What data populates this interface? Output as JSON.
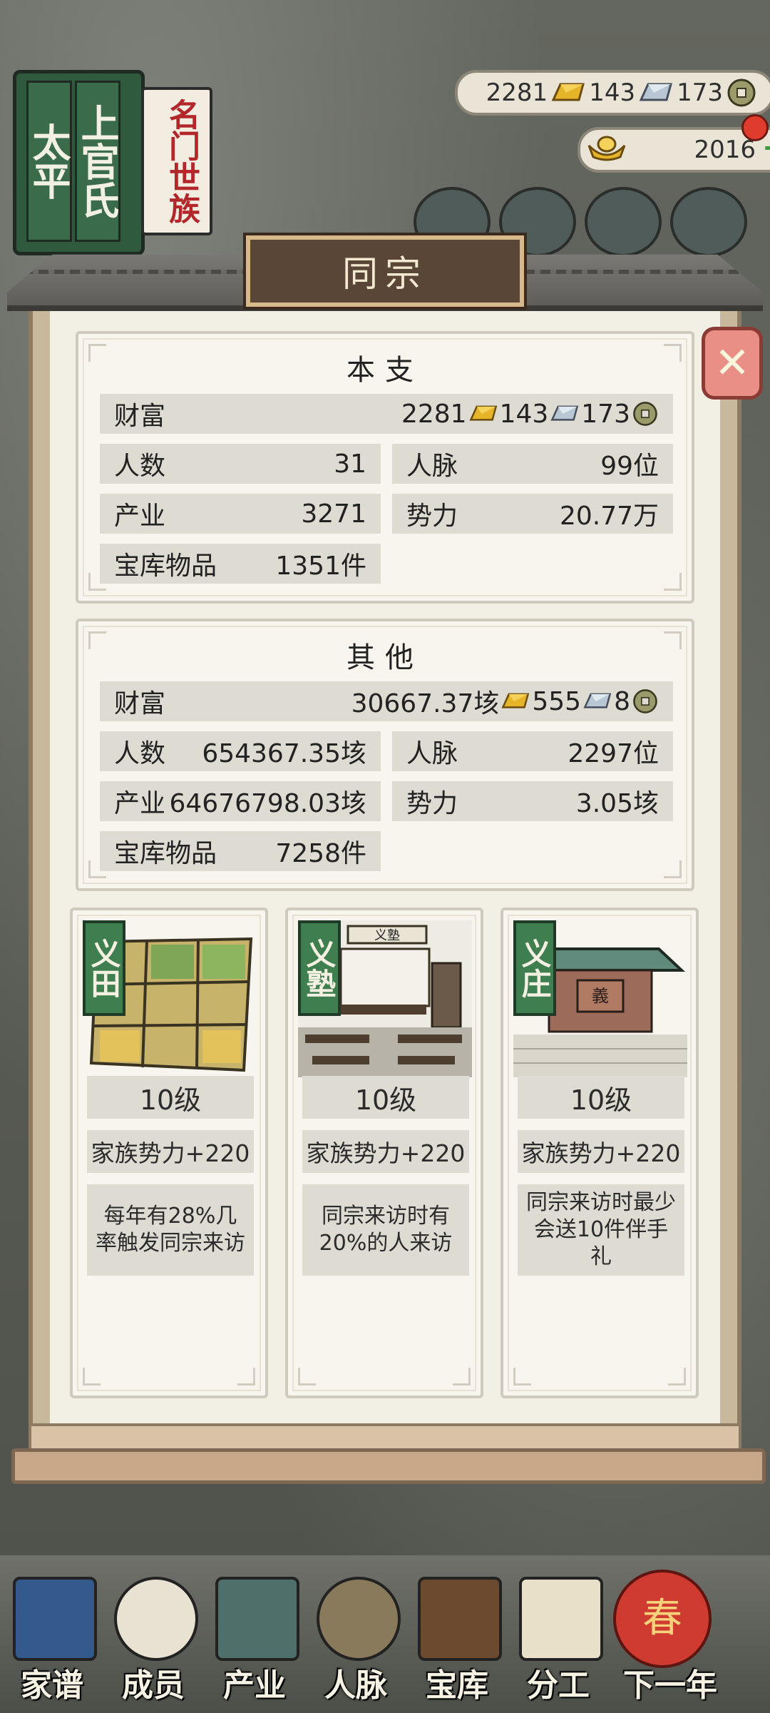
{
  "header": {
    "book_left": "太平",
    "book_right": "上官氏",
    "red_tag": "名门世族",
    "gold": "2281",
    "silver": "143",
    "coins": "173",
    "ingots": "2016"
  },
  "panel": {
    "title": "同宗",
    "main_branch": {
      "heading": "本支",
      "wealth_label": "财富",
      "wealth_gold": "2281",
      "wealth_silver": "143",
      "wealth_coins": "173",
      "population_label": "人数",
      "population": "31",
      "connections_label": "人脉",
      "connections": "99位",
      "industry_label": "产业",
      "industry": "3271",
      "influence_label": "势力",
      "influence": "20.77万",
      "treasury_label": "宝库物品",
      "treasury": "1351件"
    },
    "others": {
      "heading": "其他",
      "wealth_label": "财富",
      "wealth_gold": "30667.37垓",
      "wealth_silver": "555",
      "wealth_coins": "8",
      "population_label": "人数",
      "population": "654367.35垓",
      "connections_label": "人脉",
      "connections": "2297位",
      "industry_label": "产业",
      "industry": "64676798.03垓",
      "influence_label": "势力",
      "influence": "3.05垓",
      "treasury_label": "宝库物品",
      "treasury": "7258件"
    },
    "buildings": [
      {
        "name": "义田",
        "level": "10级",
        "bonus": "家族势力+220",
        "desc": "每年有28%几率触发同宗来访"
      },
      {
        "name": "义塾",
        "level": "10级",
        "bonus": "家族势力+220",
        "desc": "同宗来访时有20%的人来访"
      },
      {
        "name": "义庄",
        "level": "10级",
        "bonus": "家族势力+220",
        "desc": "同宗来访时最少会送10件伴手礼"
      }
    ],
    "school_sign": "义塾",
    "manor_sign": "義"
  },
  "nav": {
    "genealogy": "家谱",
    "members": "成员",
    "industry": "产业",
    "connections": "人脉",
    "treasury": "宝库",
    "division": "分工",
    "next_year": "下一年",
    "next_year_badge": "春"
  },
  "colors": {
    "gold": "#e6b428",
    "silver": "#b9c6d3",
    "coin": "#9a9a6a",
    "badge_green": "#3f7f4f",
    "close_red": "#e98f86"
  },
  "icons": [
    "gold-ingot-icon",
    "silver-ingot-icon",
    "coin-icon",
    "yuanbao-icon",
    "plus-icon",
    "close-icon"
  ]
}
